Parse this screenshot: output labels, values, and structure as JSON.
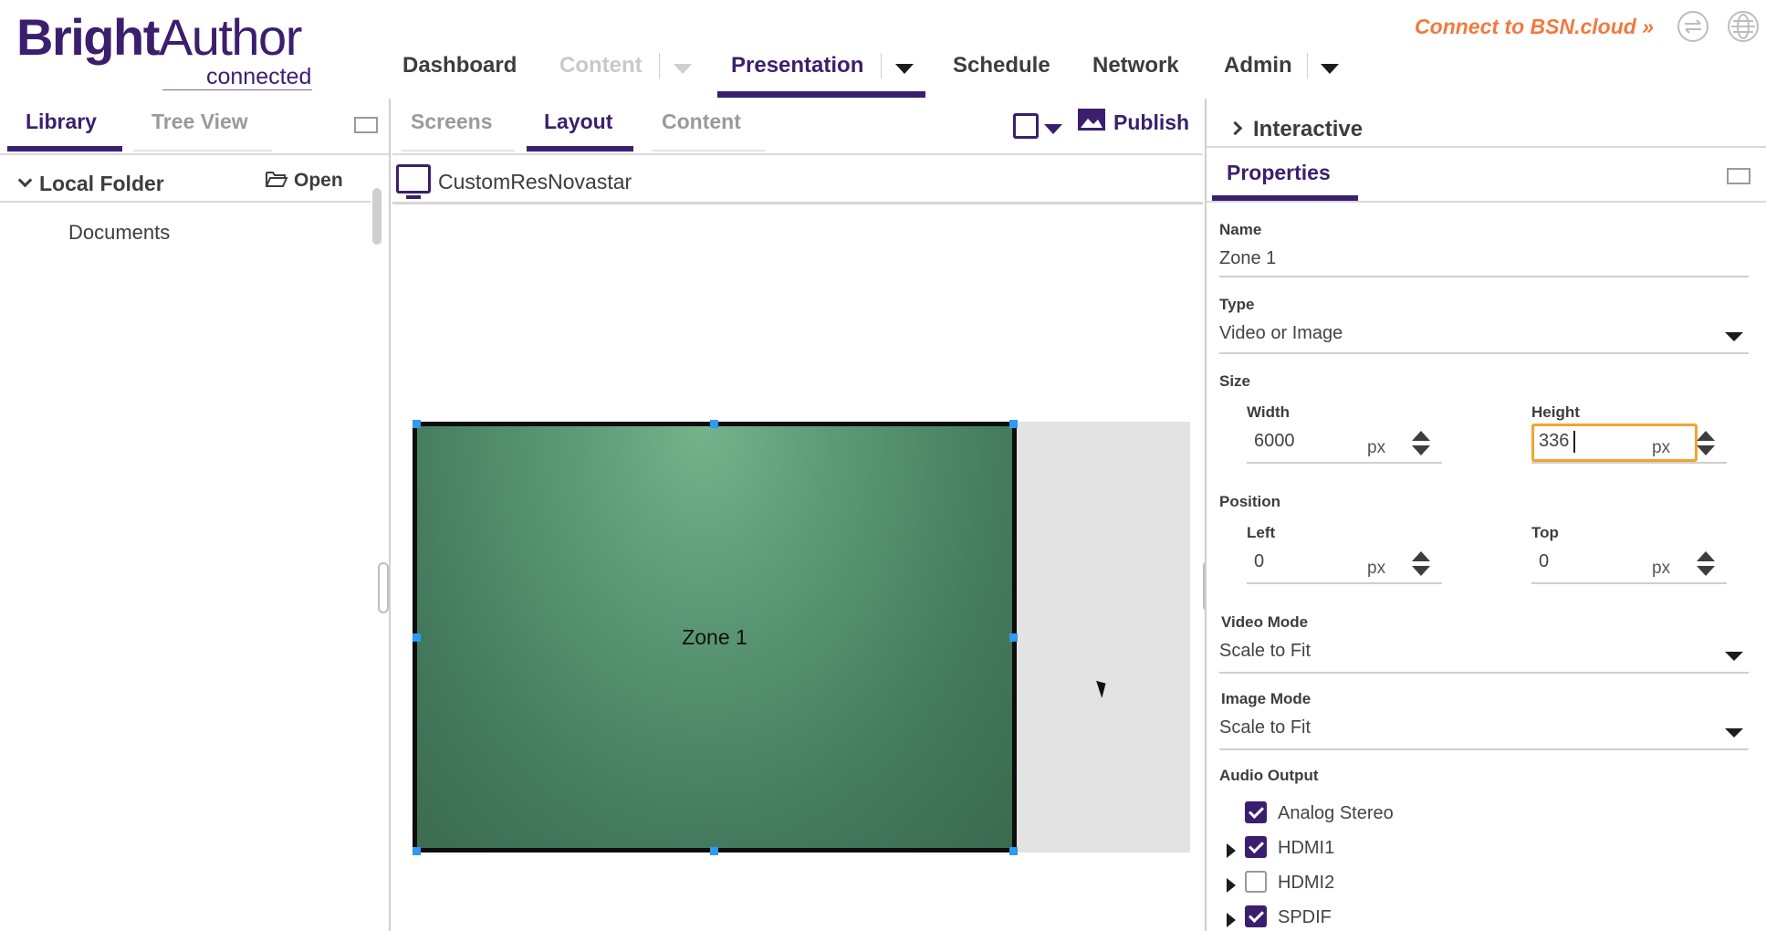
{
  "app": {
    "logo_main_bold": "Bright",
    "logo_main_light": "Author",
    "logo_sub": "connected"
  },
  "nav": {
    "items": [
      {
        "label": "Dashboard",
        "state": "enabled"
      },
      {
        "label": "Content",
        "state": "disabled"
      },
      {
        "label": "Presentation",
        "state": "active"
      },
      {
        "label": "Schedule",
        "state": "enabled"
      },
      {
        "label": "Network",
        "state": "enabled"
      },
      {
        "label": "Admin",
        "state": "enabled"
      }
    ],
    "bsn_link": "Connect to BSN.cloud »"
  },
  "left_panel": {
    "tabs": [
      {
        "label": "Library",
        "active": true
      },
      {
        "label": "Tree View",
        "active": false
      }
    ],
    "folder_label": "Local Folder",
    "open_label": "Open",
    "items": [
      "Documents"
    ]
  },
  "center_panel": {
    "tabs": [
      {
        "label": "Screens",
        "active": false
      },
      {
        "label": "Layout",
        "active": true
      },
      {
        "label": "Content",
        "active": false
      }
    ],
    "publish_label": "Publish",
    "screen_title": "CustomResNovastar",
    "zone_label": "Zone 1"
  },
  "right_panel": {
    "interactive_label": "Interactive",
    "properties_title": "Properties",
    "name_label": "Name",
    "name_value": "Zone 1",
    "type_label": "Type",
    "type_value": "Video or Image",
    "size_label": "Size",
    "width_label": "Width",
    "width_value": "6000",
    "height_label": "Height",
    "height_value": "336",
    "unit": "px",
    "position_label": "Position",
    "left_label": "Left",
    "left_value": "0",
    "top_label": "Top",
    "top_value": "0",
    "video_mode_label": "Video Mode",
    "video_mode_value": "Scale to Fit",
    "image_mode_label": "Image Mode",
    "image_mode_value": "Scale to Fit",
    "audio_output_label": "Audio Output",
    "audio_outputs": [
      {
        "label": "Analog Stereo",
        "checked": true
      },
      {
        "label": "HDMI1",
        "checked": true
      },
      {
        "label": "HDMI2",
        "checked": false
      },
      {
        "label": "SPDIF",
        "checked": true
      }
    ]
  },
  "colors": {
    "brand": "#3b1f6e",
    "accent_link": "#f07a3e",
    "focus": "#f2a431",
    "zone_green": "#4f8a68",
    "handle": "#2f9af0"
  }
}
